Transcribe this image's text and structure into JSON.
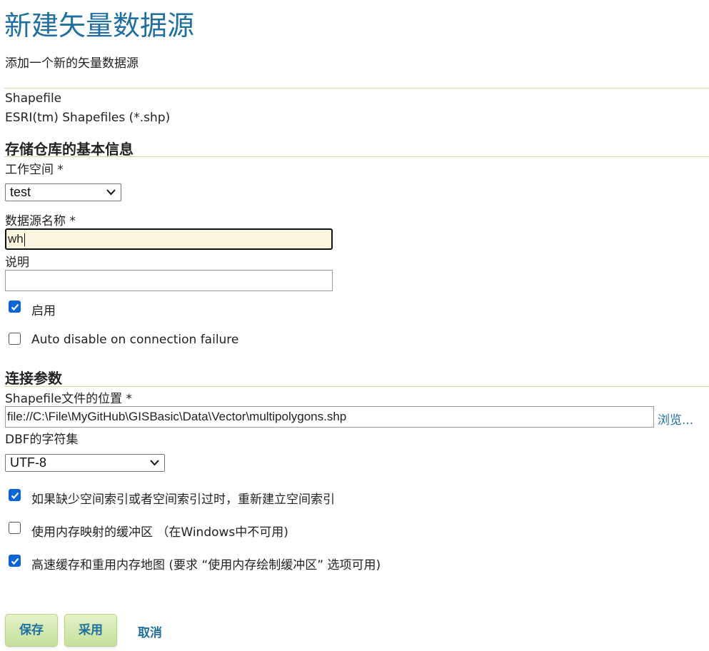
{
  "header": {
    "title": "新建矢量数据源",
    "subtitle": "添加一个新的矢量数据源"
  },
  "source": {
    "type": "Shapefile",
    "description": "ESRI(tm) Shapefiles (*.shp)"
  },
  "basic_section": {
    "heading": "存储仓库的基本信息",
    "workspace_label": "工作空间 *",
    "workspace_value": "test",
    "datasource_name_label": "数据源名称 *",
    "datasource_name_value": "wh",
    "description_label": "说明",
    "description_value": "",
    "enabled_label": "启用",
    "enabled_checked": true,
    "auto_disable_label": "Auto disable on connection failure",
    "auto_disable_checked": false
  },
  "connection_section": {
    "heading": "连接参数",
    "shapefile_location_label": "Shapefile文件的位置 *",
    "shapefile_location_value": "file://C:\\File\\MyGitHub\\GISBasic\\Data\\Vector\\multipolygons.shp",
    "browse_label": "浏览...",
    "dbf_charset_label": "DBF的字符集",
    "dbf_charset_value": "UTF-8",
    "options": [
      {
        "label": "如果缺少空间索引或者空间索引过时，重新建立空间索引",
        "checked": true
      },
      {
        "label": "使用内存映射的缓冲区 （在Windows中不可用)",
        "checked": false
      },
      {
        "label": "高速缓存和重用内存地图 (要求 “使用内存绘制缓冲区” 选项可用)",
        "checked": true
      }
    ]
  },
  "actions": {
    "save_label": "保存",
    "apply_label": "采用",
    "cancel_label": "取消"
  },
  "colors": {
    "title": "#1f6fa0",
    "link": "#1f6fa0",
    "divider": "#d4dba0",
    "checkbox_on": "#0a65d8",
    "focused_input_bg": "#fbf6de",
    "button_green": "#c4e09a"
  }
}
